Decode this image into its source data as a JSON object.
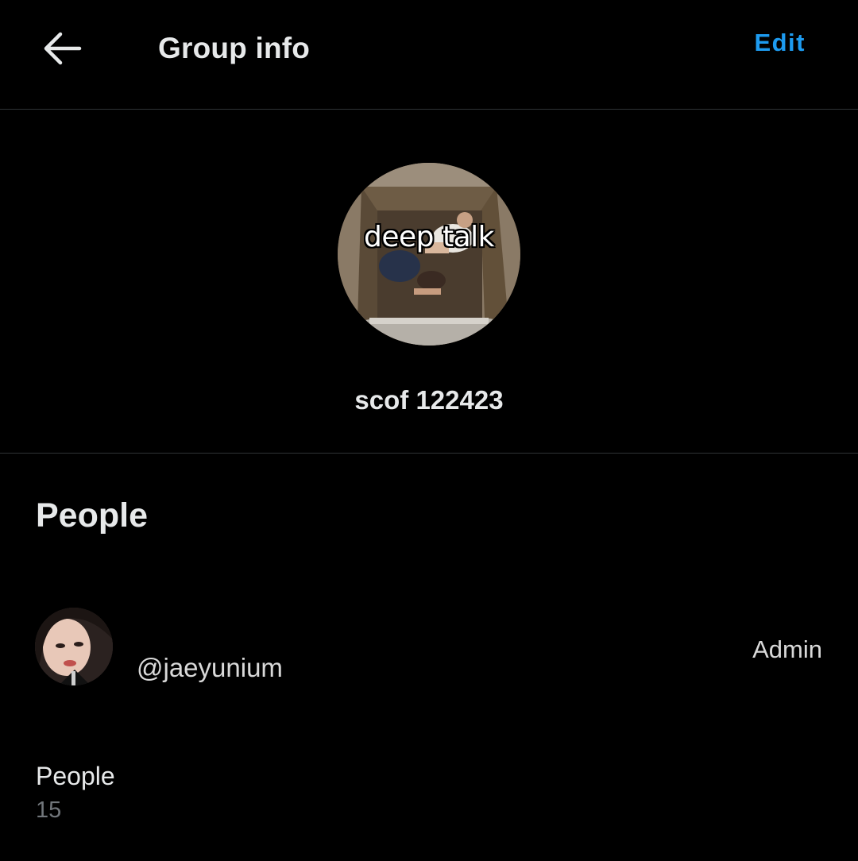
{
  "header": {
    "back_icon": "arrow-left-icon",
    "title": "Group info",
    "edit_label": "Edit",
    "accent_color": "#1d9bf0"
  },
  "group": {
    "avatar_caption": "deep talk",
    "name": "scof 122423"
  },
  "people_section": {
    "heading": "People",
    "members": [
      {
        "handle": "@jaeyunium",
        "role": "Admin"
      }
    ],
    "count_label": "People",
    "count_value": "15"
  }
}
